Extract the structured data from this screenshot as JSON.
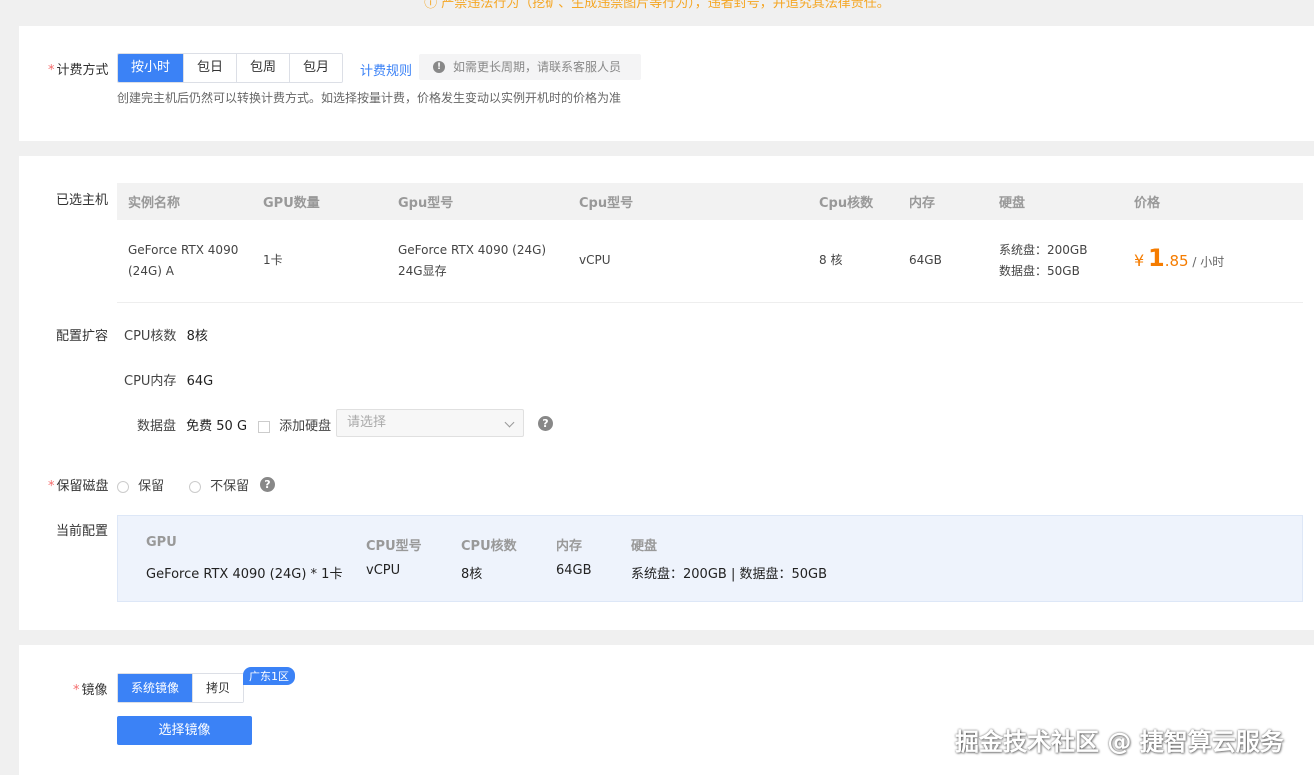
{
  "notice": "ⓘ 严禁违法行为（挖矿、生成违禁图片等行为），违者封号，并追究其法律责任。",
  "billing": {
    "label": "计费方式",
    "options": [
      "按小时",
      "包日",
      "包周",
      "包月"
    ],
    "selected": "按小时",
    "rules_link": "计费规则",
    "tip": "如需更长周期，请联系客服人员",
    "hint": "创建完主机后仍然可以转换计费方式。如选择按量计费，价格发生变动以实例开机时的价格为准"
  },
  "selected_host": {
    "label": "已选主机",
    "columns": [
      "实例名称",
      "GPU数量",
      "Gpu型号",
      "Cpu型号",
      "Cpu核数",
      "内存",
      "硬盘",
      "价格"
    ],
    "row": {
      "name_line1": "GeForce RTX 4090",
      "name_line2": "(24G) A",
      "gpu_count": "1卡",
      "gpu_model_line1": "GeForce RTX 4090 (24G)",
      "gpu_model_line2": "24G显存",
      "cpu_model": "vCPU",
      "cpu_cores": "8 核",
      "memory": "64GB",
      "disk_system": "系统盘：200GB",
      "disk_data": "数据盘：50GB",
      "price_symbol": "¥",
      "price_int": "1",
      "price_dec": ".85",
      "price_unit": "/ 小时"
    }
  },
  "expansion": {
    "label": "配置扩容",
    "cpu_cores_label": "CPU核数",
    "cpu_cores_value": "8核",
    "cpu_mem_label": "CPU内存",
    "cpu_mem_value": "64G",
    "data_disk_label": "数据盘",
    "data_disk_value": "免费 50 G",
    "add_disk_label": "添加硬盘",
    "select_placeholder": "请选择"
  },
  "keep_disk": {
    "label": "保留磁盘",
    "options": [
      "保留",
      "不保留"
    ]
  },
  "current_config": {
    "label": "当前配置",
    "headers": [
      "GPU",
      "CPU型号",
      "CPU核数",
      "内存",
      "硬盘"
    ],
    "values": [
      "GeForce RTX 4090 (24G) * 1卡",
      "vCPU",
      "8核",
      "64GB",
      "系统盘：200GB | 数据盘：50GB"
    ]
  },
  "image": {
    "label": "镜像",
    "options": [
      "系统镜像",
      "拷贝"
    ],
    "selected": "系统镜像",
    "region_badge": "广东1区",
    "select_button": "选择镜像"
  },
  "watermark": "掘金技术社区 @ 捷智算云服务",
  "colors": {
    "primary": "#3b82f6",
    "price": "#f57c00",
    "required": "#f56c6c",
    "notice": "#f5a623"
  }
}
